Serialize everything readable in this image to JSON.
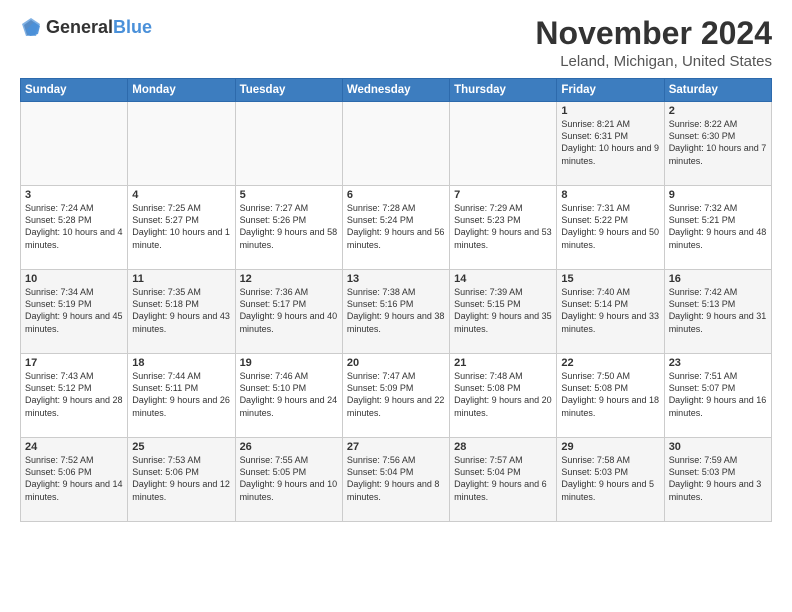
{
  "logo": {
    "general": "General",
    "blue": "Blue"
  },
  "title": {
    "month_year": "November 2024",
    "location": "Leland, Michigan, United States"
  },
  "headers": [
    "Sunday",
    "Monday",
    "Tuesday",
    "Wednesday",
    "Thursday",
    "Friday",
    "Saturday"
  ],
  "weeks": [
    [
      {
        "day": "",
        "info": ""
      },
      {
        "day": "",
        "info": ""
      },
      {
        "day": "",
        "info": ""
      },
      {
        "day": "",
        "info": ""
      },
      {
        "day": "",
        "info": ""
      },
      {
        "day": "1",
        "info": "Sunrise: 8:21 AM\nSunset: 6:31 PM\nDaylight: 10 hours and 9 minutes."
      },
      {
        "day": "2",
        "info": "Sunrise: 8:22 AM\nSunset: 6:30 PM\nDaylight: 10 hours and 7 minutes."
      }
    ],
    [
      {
        "day": "3",
        "info": "Sunrise: 7:24 AM\nSunset: 5:28 PM\nDaylight: 10 hours and 4 minutes."
      },
      {
        "day": "4",
        "info": "Sunrise: 7:25 AM\nSunset: 5:27 PM\nDaylight: 10 hours and 1 minute."
      },
      {
        "day": "5",
        "info": "Sunrise: 7:27 AM\nSunset: 5:26 PM\nDaylight: 9 hours and 58 minutes."
      },
      {
        "day": "6",
        "info": "Sunrise: 7:28 AM\nSunset: 5:24 PM\nDaylight: 9 hours and 56 minutes."
      },
      {
        "day": "7",
        "info": "Sunrise: 7:29 AM\nSunset: 5:23 PM\nDaylight: 9 hours and 53 minutes."
      },
      {
        "day": "8",
        "info": "Sunrise: 7:31 AM\nSunset: 5:22 PM\nDaylight: 9 hours and 50 minutes."
      },
      {
        "day": "9",
        "info": "Sunrise: 7:32 AM\nSunset: 5:21 PM\nDaylight: 9 hours and 48 minutes."
      }
    ],
    [
      {
        "day": "10",
        "info": "Sunrise: 7:34 AM\nSunset: 5:19 PM\nDaylight: 9 hours and 45 minutes."
      },
      {
        "day": "11",
        "info": "Sunrise: 7:35 AM\nSunset: 5:18 PM\nDaylight: 9 hours and 43 minutes."
      },
      {
        "day": "12",
        "info": "Sunrise: 7:36 AM\nSunset: 5:17 PM\nDaylight: 9 hours and 40 minutes."
      },
      {
        "day": "13",
        "info": "Sunrise: 7:38 AM\nSunset: 5:16 PM\nDaylight: 9 hours and 38 minutes."
      },
      {
        "day": "14",
        "info": "Sunrise: 7:39 AM\nSunset: 5:15 PM\nDaylight: 9 hours and 35 minutes."
      },
      {
        "day": "15",
        "info": "Sunrise: 7:40 AM\nSunset: 5:14 PM\nDaylight: 9 hours and 33 minutes."
      },
      {
        "day": "16",
        "info": "Sunrise: 7:42 AM\nSunset: 5:13 PM\nDaylight: 9 hours and 31 minutes."
      }
    ],
    [
      {
        "day": "17",
        "info": "Sunrise: 7:43 AM\nSunset: 5:12 PM\nDaylight: 9 hours and 28 minutes."
      },
      {
        "day": "18",
        "info": "Sunrise: 7:44 AM\nSunset: 5:11 PM\nDaylight: 9 hours and 26 minutes."
      },
      {
        "day": "19",
        "info": "Sunrise: 7:46 AM\nSunset: 5:10 PM\nDaylight: 9 hours and 24 minutes."
      },
      {
        "day": "20",
        "info": "Sunrise: 7:47 AM\nSunset: 5:09 PM\nDaylight: 9 hours and 22 minutes."
      },
      {
        "day": "21",
        "info": "Sunrise: 7:48 AM\nSunset: 5:08 PM\nDaylight: 9 hours and 20 minutes."
      },
      {
        "day": "22",
        "info": "Sunrise: 7:50 AM\nSunset: 5:08 PM\nDaylight: 9 hours and 18 minutes."
      },
      {
        "day": "23",
        "info": "Sunrise: 7:51 AM\nSunset: 5:07 PM\nDaylight: 9 hours and 16 minutes."
      }
    ],
    [
      {
        "day": "24",
        "info": "Sunrise: 7:52 AM\nSunset: 5:06 PM\nDaylight: 9 hours and 14 minutes."
      },
      {
        "day": "25",
        "info": "Sunrise: 7:53 AM\nSunset: 5:06 PM\nDaylight: 9 hours and 12 minutes."
      },
      {
        "day": "26",
        "info": "Sunrise: 7:55 AM\nSunset: 5:05 PM\nDaylight: 9 hours and 10 minutes."
      },
      {
        "day": "27",
        "info": "Sunrise: 7:56 AM\nSunset: 5:04 PM\nDaylight: 9 hours and 8 minutes."
      },
      {
        "day": "28",
        "info": "Sunrise: 7:57 AM\nSunset: 5:04 PM\nDaylight: 9 hours and 6 minutes."
      },
      {
        "day": "29",
        "info": "Sunrise: 7:58 AM\nSunset: 5:03 PM\nDaylight: 9 hours and 5 minutes."
      },
      {
        "day": "30",
        "info": "Sunrise: 7:59 AM\nSunset: 5:03 PM\nDaylight: 9 hours and 3 minutes."
      }
    ]
  ]
}
